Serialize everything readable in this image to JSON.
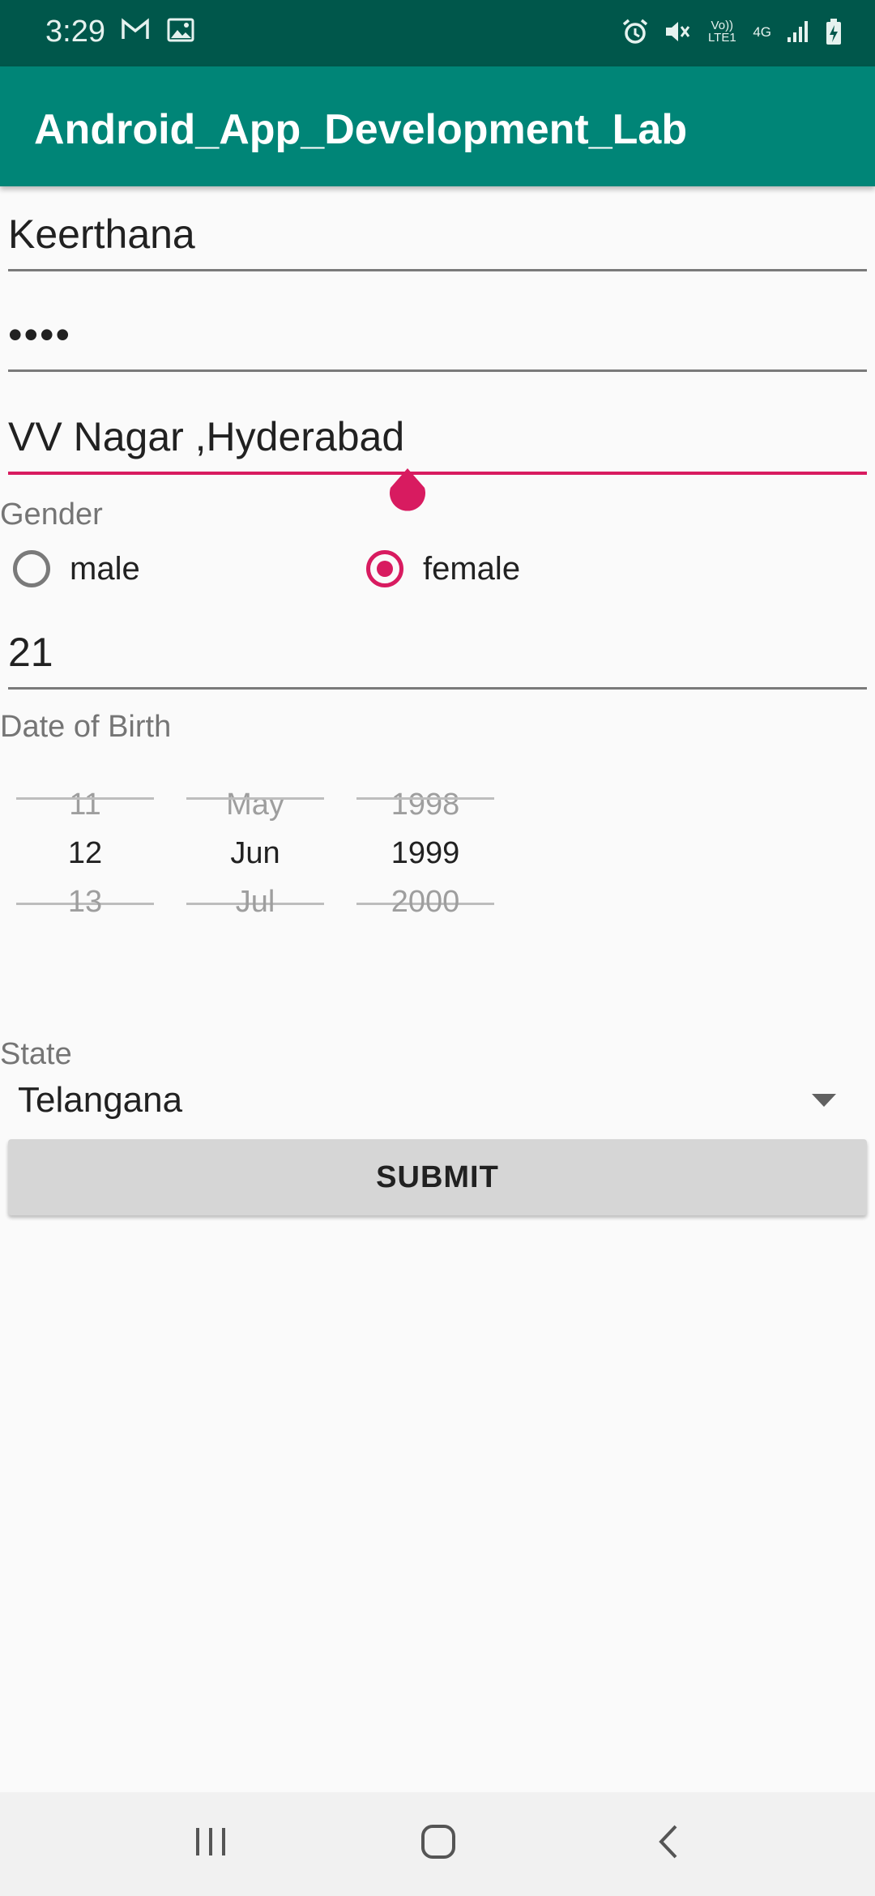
{
  "status_bar": {
    "time": "3:29",
    "left_icons": [
      "gmail-icon",
      "image-icon"
    ],
    "right_icons": [
      "alarm-icon",
      "mute-icon",
      "volte-icon",
      "4g-icon",
      "signal-icon",
      "battery-charging-icon"
    ],
    "volte_text": "Vo)) LTE1",
    "network_text": "4G"
  },
  "app_bar": {
    "title": "Android_App_Development_Lab"
  },
  "form": {
    "name_value": "Keerthana",
    "password_value": "••••",
    "address_value": "VV Nagar ,Hyderabad",
    "gender_label": "Gender",
    "gender_options": [
      {
        "label": "male",
        "checked": false
      },
      {
        "label": "female",
        "checked": true
      }
    ],
    "age_value": "21",
    "dob_label": "Date of Birth",
    "date_picker": {
      "day": {
        "prev": "11",
        "current": "12",
        "next": "13"
      },
      "month": {
        "prev": "May",
        "current": "Jun",
        "next": "Jul"
      },
      "year": {
        "prev": "1998",
        "current": "1999",
        "next": "2000"
      }
    },
    "state_label": "State",
    "state_value": "Telangana",
    "submit_label": "SUBMIT"
  },
  "colors": {
    "status_bar": "#00574b",
    "app_bar": "#008577",
    "accent": "#d81b60"
  },
  "nav_bar": {
    "buttons": [
      "recents-icon",
      "home-icon",
      "back-icon"
    ]
  }
}
